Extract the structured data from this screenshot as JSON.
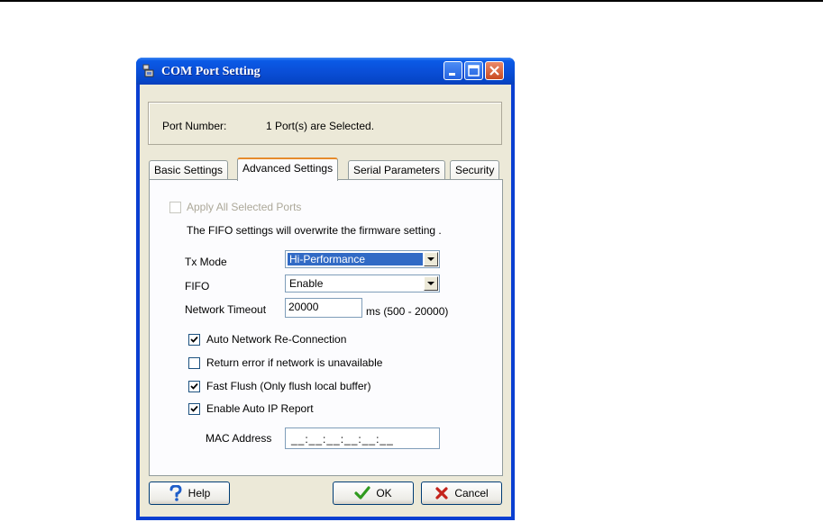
{
  "window": {
    "title": "COM Port Setting"
  },
  "port": {
    "label": "Port Number:",
    "value": "1 Port(s) are Selected."
  },
  "tabs": [
    {
      "label": "Basic Settings",
      "active": false
    },
    {
      "label": "Advanced Settings",
      "active": true
    },
    {
      "label": "Serial Parameters",
      "active": false
    },
    {
      "label": "Security",
      "active": false
    }
  ],
  "advanced": {
    "apply_all": {
      "label": "Apply All Selected Ports",
      "checked": false,
      "enabled": false
    },
    "fifo_note": "The FIFO settings will overwrite the firmware setting .",
    "tx_mode": {
      "label": "Tx Mode",
      "value": "Hi-Performance"
    },
    "fifo": {
      "label": "FIFO",
      "value": "Enable"
    },
    "network_timeout": {
      "label": "Network Timeout",
      "value": "20000",
      "hint": "ms (500 - 20000)"
    },
    "auto_reconnect": {
      "label": "Auto Network Re-Connection",
      "checked": true
    },
    "return_error": {
      "label": "Return error if network is unavailable",
      "checked": false
    },
    "fast_flush": {
      "label": "Fast Flush (Only flush local buffer)",
      "checked": true
    },
    "auto_ip_report": {
      "label": "Enable Auto IP Report",
      "checked": true
    },
    "mac_address": {
      "label": "MAC Address",
      "value": "__:__:__:__:__:__"
    }
  },
  "buttons": {
    "help": "Help",
    "ok": "OK",
    "cancel": "Cancel"
  },
  "colors": {
    "titlebar": "#0a4fd8",
    "dialog_bg": "#ece9d8",
    "selection": "#316ac5",
    "ok_check": "#2f9a1e",
    "cancel_x": "#c4231c",
    "help_icon": "#1f5ec9"
  },
  "icons": [
    "app-icon",
    "minimize-icon",
    "maximize-icon",
    "close-icon",
    "help-icon",
    "ok-check-icon",
    "cancel-x-icon",
    "chevron-down-icon",
    "checkmark-icon"
  ]
}
